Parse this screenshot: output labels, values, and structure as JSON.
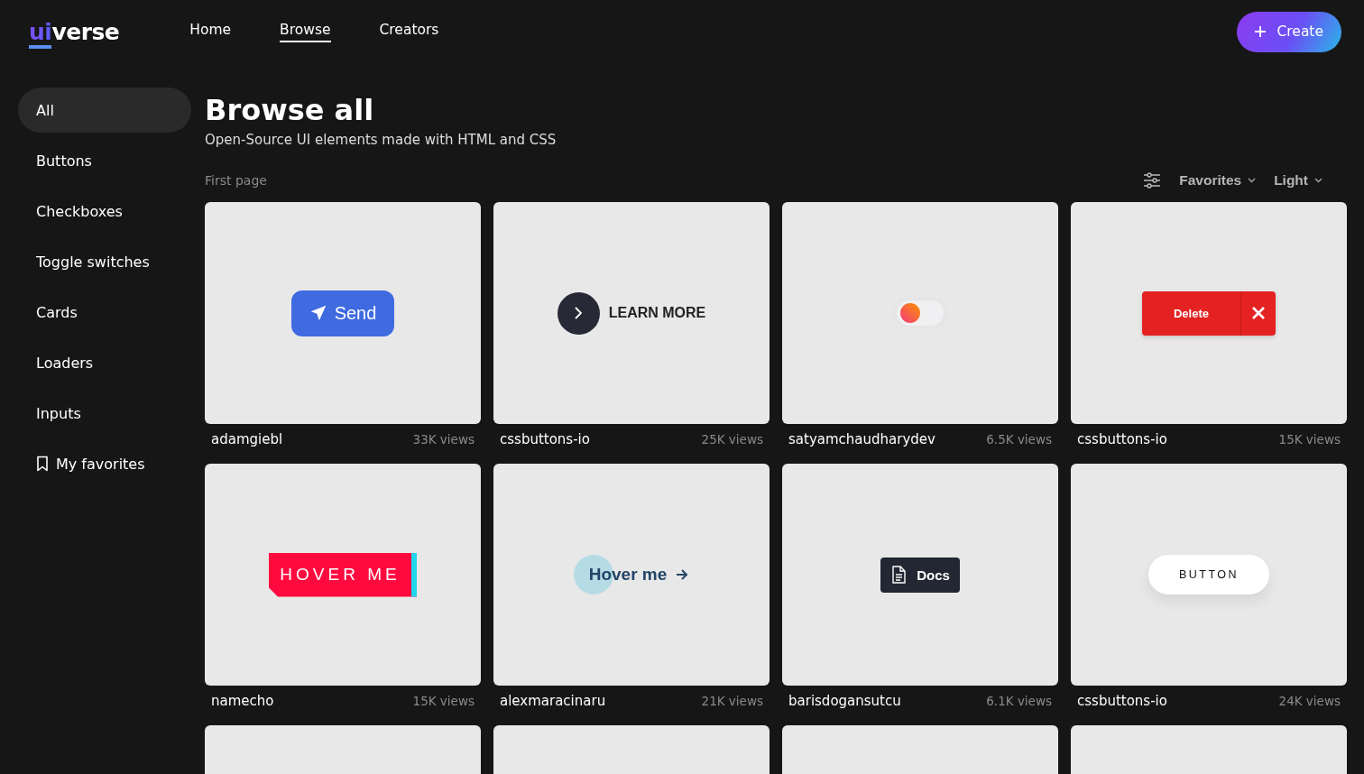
{
  "header": {
    "logo": {
      "accent": "ui",
      "rest": "verse"
    },
    "nav": [
      {
        "label": "Home",
        "selected": false
      },
      {
        "label": "Browse",
        "selected": true
      },
      {
        "label": "Creators",
        "selected": false
      }
    ],
    "create_button": {
      "label": "Create"
    }
  },
  "sidebar": {
    "items": [
      {
        "label": "All",
        "selected": true,
        "kind": "category"
      },
      {
        "label": "Buttons",
        "selected": false,
        "kind": "category"
      },
      {
        "label": "Checkboxes",
        "selected": false,
        "kind": "category"
      },
      {
        "label": "Toggle switches",
        "selected": false,
        "kind": "category"
      },
      {
        "label": "Cards",
        "selected": false,
        "kind": "category"
      },
      {
        "label": "Loaders",
        "selected": false,
        "kind": "category"
      },
      {
        "label": "Inputs",
        "selected": false,
        "kind": "category"
      },
      {
        "label": "My favorites",
        "selected": false,
        "kind": "favorites"
      }
    ]
  },
  "main": {
    "title": "Browse all",
    "subtitle": "Open-Source UI elements made with HTML and CSS",
    "page_label": "First page",
    "filters": [
      {
        "label": "Favorites"
      },
      {
        "label": "Light"
      }
    ],
    "cards": [
      {
        "kind": "send",
        "label": "Send",
        "author": "adamgiebl",
        "views": "33K views"
      },
      {
        "kind": "learn",
        "label": "LEARN MORE",
        "author": "cssbuttons-io",
        "views": "25K views"
      },
      {
        "kind": "toggle",
        "checked": false,
        "author": "satyamchaudharydev",
        "views": "6.5K views"
      },
      {
        "kind": "delete",
        "label": "Delete",
        "author": "cssbuttons-io",
        "views": "15K views"
      },
      {
        "kind": "hover-block",
        "label": "HOVER ME",
        "author": "namecho",
        "views": "15K views"
      },
      {
        "kind": "hover-arrow",
        "label": "Hover me",
        "author": "alexmaracinaru",
        "views": "21K views"
      },
      {
        "kind": "docs",
        "label": "Docs",
        "author": "barisdogansutcu",
        "views": "6.1K views"
      },
      {
        "kind": "pill",
        "label": "BUTTON",
        "author": "cssbuttons-io",
        "views": "24K views"
      },
      {
        "kind": "empty"
      },
      {
        "kind": "empty"
      },
      {
        "kind": "empty"
      },
      {
        "kind": "empty"
      }
    ]
  }
}
